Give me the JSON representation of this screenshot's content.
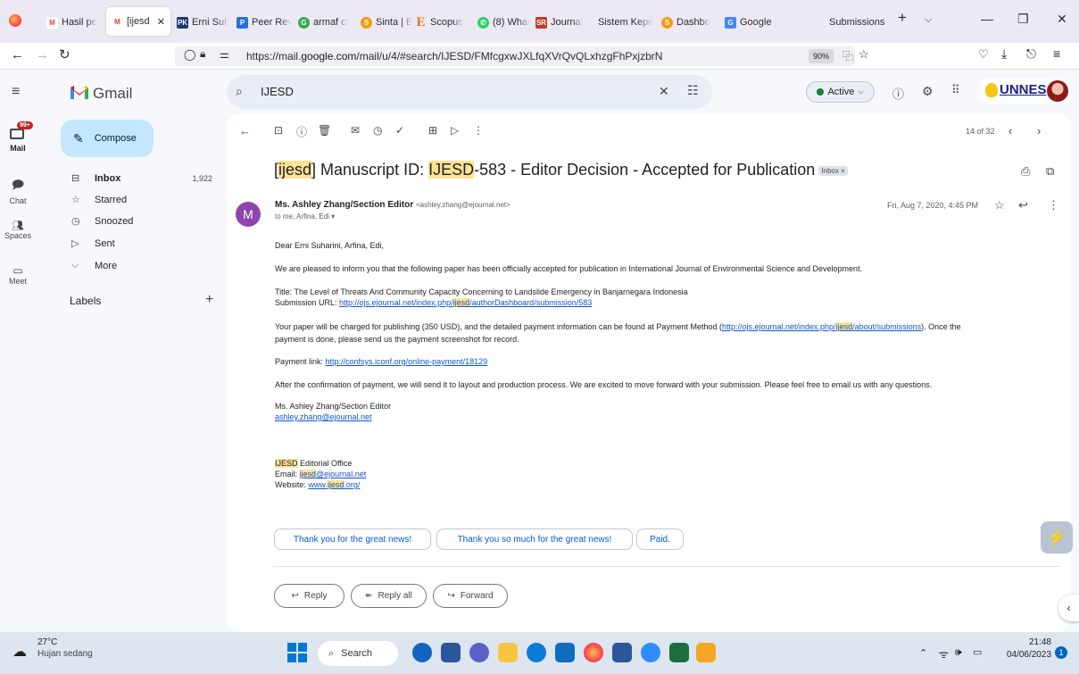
{
  "browser": {
    "tabs": [
      {
        "label": "Hasil pe",
        "icon": "gmail-icon"
      },
      {
        "label": "[ijesd",
        "icon": "gmail-icon",
        "active": true
      },
      {
        "label": "Erni Suh",
        "icon": "pkm-icon"
      },
      {
        "label": "Peer Rev",
        "icon": "peer-review-icon"
      },
      {
        "label": "armaf cl",
        "icon": "google-icon"
      },
      {
        "label": "Sinta | B",
        "icon": "sinta-icon"
      },
      {
        "label": "Scopus",
        "icon": "scopus-icon"
      },
      {
        "label": "(8) What",
        "icon": "whatsapp-icon"
      },
      {
        "label": "Journal",
        "icon": "journal-icon"
      },
      {
        "label": "Sistem Kepe",
        "icon": "sistem-icon"
      },
      {
        "label": "Dashbo",
        "icon": "dashboard-icon"
      },
      {
        "label": "Google",
        "icon": "google-scholar-icon"
      },
      {
        "label": "Submissions",
        "icon": "submissions-icon"
      }
    ],
    "url": "https://mail.google.com/mail/u/4/#search/IJESD/FMfcgxwJXLfqXVrQvQLxhzgFhPxjzbrN",
    "url_prefix": "https://mail.",
    "url_domain": "google.com",
    "url_path": "/mail/u/4/#search/IJESD/FMfcgxwJXLfqXVrQvQLxhzgFhPxjzbrN",
    "zoom": "90%"
  },
  "gmail": {
    "logo": "Gmail",
    "search_query": "IJESD",
    "status": "Active",
    "org_logo": "UNNES",
    "rail": [
      {
        "label": "Mail",
        "badge": "99+"
      },
      {
        "label": "Chat"
      },
      {
        "label": "Spaces"
      },
      {
        "label": "Meet"
      }
    ],
    "compose": "Compose",
    "nav": [
      {
        "label": "Inbox",
        "count": "1,922"
      },
      {
        "label": "Starred"
      },
      {
        "label": "Snoozed"
      },
      {
        "label": "Sent"
      },
      {
        "label": "More"
      }
    ],
    "labels_heading": "Labels",
    "pager": "14 of 32"
  },
  "email": {
    "subject_pre": "[",
    "subject_hl1": "ijesd",
    "subject_mid": "] Manuscript ID: ",
    "subject_hl2": "IJESD",
    "subject_post": "-583 - Editor Decision - Accepted for Publication",
    "inbox_tag": "Inbox ×",
    "avatar_letter": "M",
    "sender_name": "Ms. Ashley Zhang/Section Editor",
    "sender_email": "<ashley.zhang@ejournal.net>",
    "to": "to me, Arfina, Edi",
    "date": "Fri, Aug 7, 2020, 4:45 PM",
    "greeting": "Dear Erni Suharini, Arfina, Edi,",
    "p1": "We are pleased to inform you that the following paper has been officially accepted for publication in International Journal of Environmental Science and Development.",
    "title_line": "Title: The Level of Threats And Community Capacity Concerning to Landslide Emergency in Banjarnegara Indonesia",
    "submission_label": "Submission URL: ",
    "submission_pre": "http://ojs.ejournal.net/index.php/",
    "submission_hl": "ijesd",
    "submission_post": "/authorDashboard/submission/583",
    "p3a": "Your paper will be charged for publishing (350 USD), and the detailed payment information can be found at Payment Method (",
    "p3_link_pre": "http://ojs.ejournal.net/index.php/",
    "p3_link_hl": "ijesd",
    "p3_link_post": "/about/submissions",
    "p3b": "). Once the",
    "p3c": "payment is done, please send us the payment screenshot for record.",
    "payment_label": "Payment link: ",
    "payment_link": "http://confsys.iconf.org/online-payment/18129",
    "p5": "After the confirmation of payment, we will send it to layout and production process. We are excited to move forward with your submission. Please feel free to email us with any questions.",
    "sig_name": "Ms. Ashley Zhang/Section Editor",
    "sig_email": "ashley.zhang@ejournal.net",
    "office_hl": "IJESD",
    "office_post": " Editorial Office",
    "office_email_label": "Email: ",
    "office_email_hl": "ijesd",
    "office_email_post": "@ejournal.net",
    "office_web_label": "Website: ",
    "office_web_pre": "www.",
    "office_web_hl": "ijesd",
    "office_web_post": ".org/",
    "smart_replies": [
      "Thank you for the great news!",
      "Thank you so much for the great news!",
      "Paid."
    ],
    "actions": [
      "Reply",
      "Reply all",
      "Forward"
    ]
  },
  "taskbar": {
    "temp": "27°C",
    "weather": "Hujan sedang",
    "search": "Search",
    "time": "21:48",
    "date": "04/06/2023"
  }
}
